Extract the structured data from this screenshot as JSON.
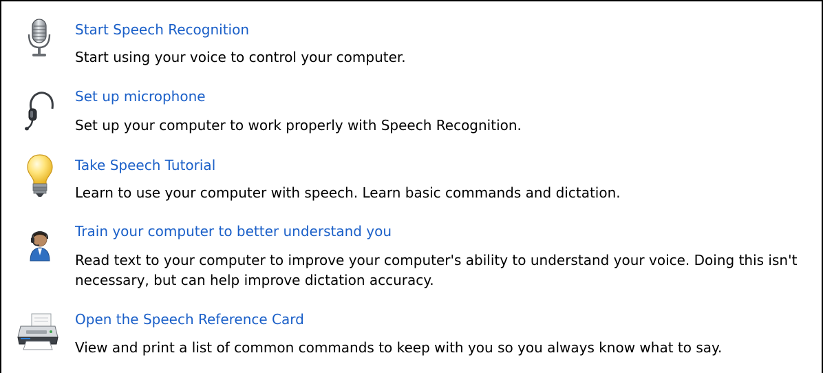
{
  "tasks": [
    {
      "icon": "microphone-icon",
      "link": "Start Speech Recognition",
      "description": "Start using your voice to control your computer."
    },
    {
      "icon": "headset-icon",
      "link": "Set up microphone",
      "description": "Set up your computer to work properly with Speech Recognition."
    },
    {
      "icon": "lightbulb-icon",
      "link": "Take Speech Tutorial",
      "description": "Learn to use your computer with speech.  Learn basic commands and dictation."
    },
    {
      "icon": "user-training-icon",
      "link": "Train your computer to better understand you",
      "description": "Read text to your computer to improve your computer's ability to understand your voice.  Doing this isn't necessary, but can help improve dictation accuracy."
    },
    {
      "icon": "printer-icon",
      "link": "Open the Speech Reference Card",
      "description": "View and print a list of common commands to keep with you so you always know what to say."
    }
  ],
  "colors": {
    "link": "#1a5fc8",
    "text": "#000000",
    "border": "#000000",
    "background": "#ffffff"
  }
}
